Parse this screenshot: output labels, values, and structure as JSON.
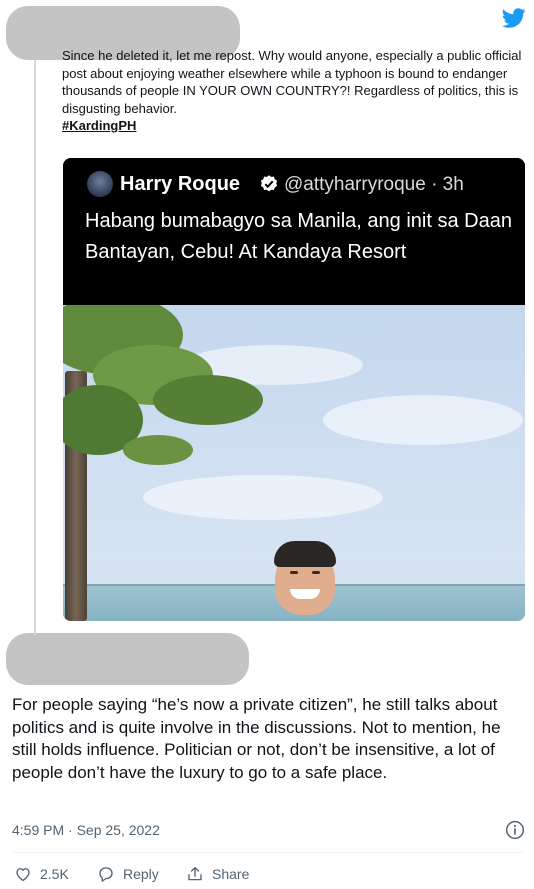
{
  "parent_tweet": {
    "text": "Since he deleted it, let me repost. Why would anyone, especially a public official post about enjoying weather elsewhere while a typhoon is bound to endanger thousands of people IN YOUR OWN COUNTRY?! Regardless of politics, this is disgusting behavior.",
    "hashtag": "#KardingPH"
  },
  "embedded_tweet": {
    "name": "Harry Roque",
    "handle": "@attyharryroque · 3h",
    "text": "Habang bumabagyo sa Manila, ang init sa Daan Bantayan, Cebu! At Kandaya Resort"
  },
  "reply_tweet": {
    "text": "For people saying “he’s now a private citizen”, he still talks about politics and is quite involve in the discussions. Not to mention, he still holds influence. Politician or not, don’t be insensitive, a lot of people don’t have the luxury to go to a safe place.",
    "timestamp": "4:59 PM · Sep 25, 2022"
  },
  "actions": {
    "like_count": "2.5K",
    "reply_label": "Reply",
    "share_label": "Share"
  },
  "colors": {
    "twitter_blue": "#1d9bf0",
    "muted_text": "#536471",
    "redaction": "#c4c4c4"
  },
  "icons": {
    "brand": "twitter-bird-icon",
    "verified": "verified-badge-icon",
    "info": "info-icon",
    "like": "heart-icon",
    "reply": "reply-bubble-icon",
    "share": "share-icon"
  }
}
